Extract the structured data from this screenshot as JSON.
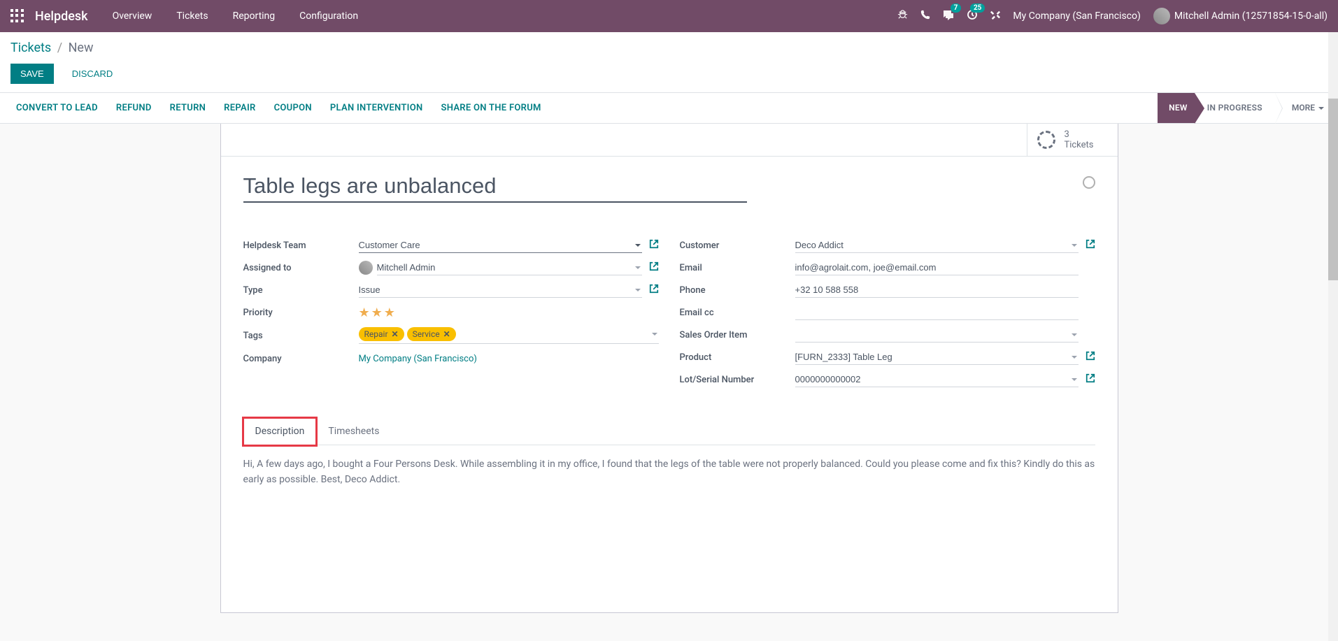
{
  "nav": {
    "brand": "Helpdesk",
    "menu": [
      "Overview",
      "Tickets",
      "Reporting",
      "Configuration"
    ],
    "messages_badge": "7",
    "activities_badge": "25",
    "company": "My Company (San Francisco)",
    "user": "Mitchell Admin (12571854-15-0-all)"
  },
  "breadcrumb": {
    "parent": "Tickets",
    "current": "New"
  },
  "buttons": {
    "save": "SAVE",
    "discard": "DISCARD"
  },
  "actions": [
    "CONVERT TO LEAD",
    "REFUND",
    "RETURN",
    "REPAIR",
    "COUPON",
    "PLAN INTERVENTION",
    "SHARE ON THE FORUM"
  ],
  "status": {
    "new": "NEW",
    "in_progress": "IN PROGRESS",
    "more": "MORE"
  },
  "stat": {
    "count": "3",
    "label": "Tickets"
  },
  "title": "Table legs are unbalanced",
  "fields_left": {
    "team_label": "Helpdesk Team",
    "team_value": "Customer Care",
    "assigned_label": "Assigned to",
    "assigned_value": "Mitchell Admin",
    "type_label": "Type",
    "type_value": "Issue",
    "priority_label": "Priority",
    "tags_label": "Tags",
    "tag_repair": "Repair",
    "tag_service": "Service",
    "company_label": "Company",
    "company_value": "My Company (San Francisco)"
  },
  "fields_right": {
    "customer_label": "Customer",
    "customer_value": "Deco Addict",
    "email_label": "Email",
    "email_value": "info@agrolait.com, joe@email.com",
    "phone_label": "Phone",
    "phone_value": "+32 10 588 558",
    "emailcc_label": "Email cc",
    "emailcc_value": "",
    "soi_label": "Sales Order Item",
    "soi_value": "",
    "product_label": "Product",
    "product_value": "[FURN_2333] Table Leg",
    "lot_label": "Lot/Serial Number",
    "lot_value": "0000000000002"
  },
  "tabs": {
    "description": "Description",
    "timesheets": "Timesheets"
  },
  "description_text": "Hi, A few days ago, I bought a Four Persons Desk. While assembling it in my office, I found that the legs of the table were not properly balanced. Could you please come and fix this? Kindly do this as early as possible. Best, Deco Addict."
}
